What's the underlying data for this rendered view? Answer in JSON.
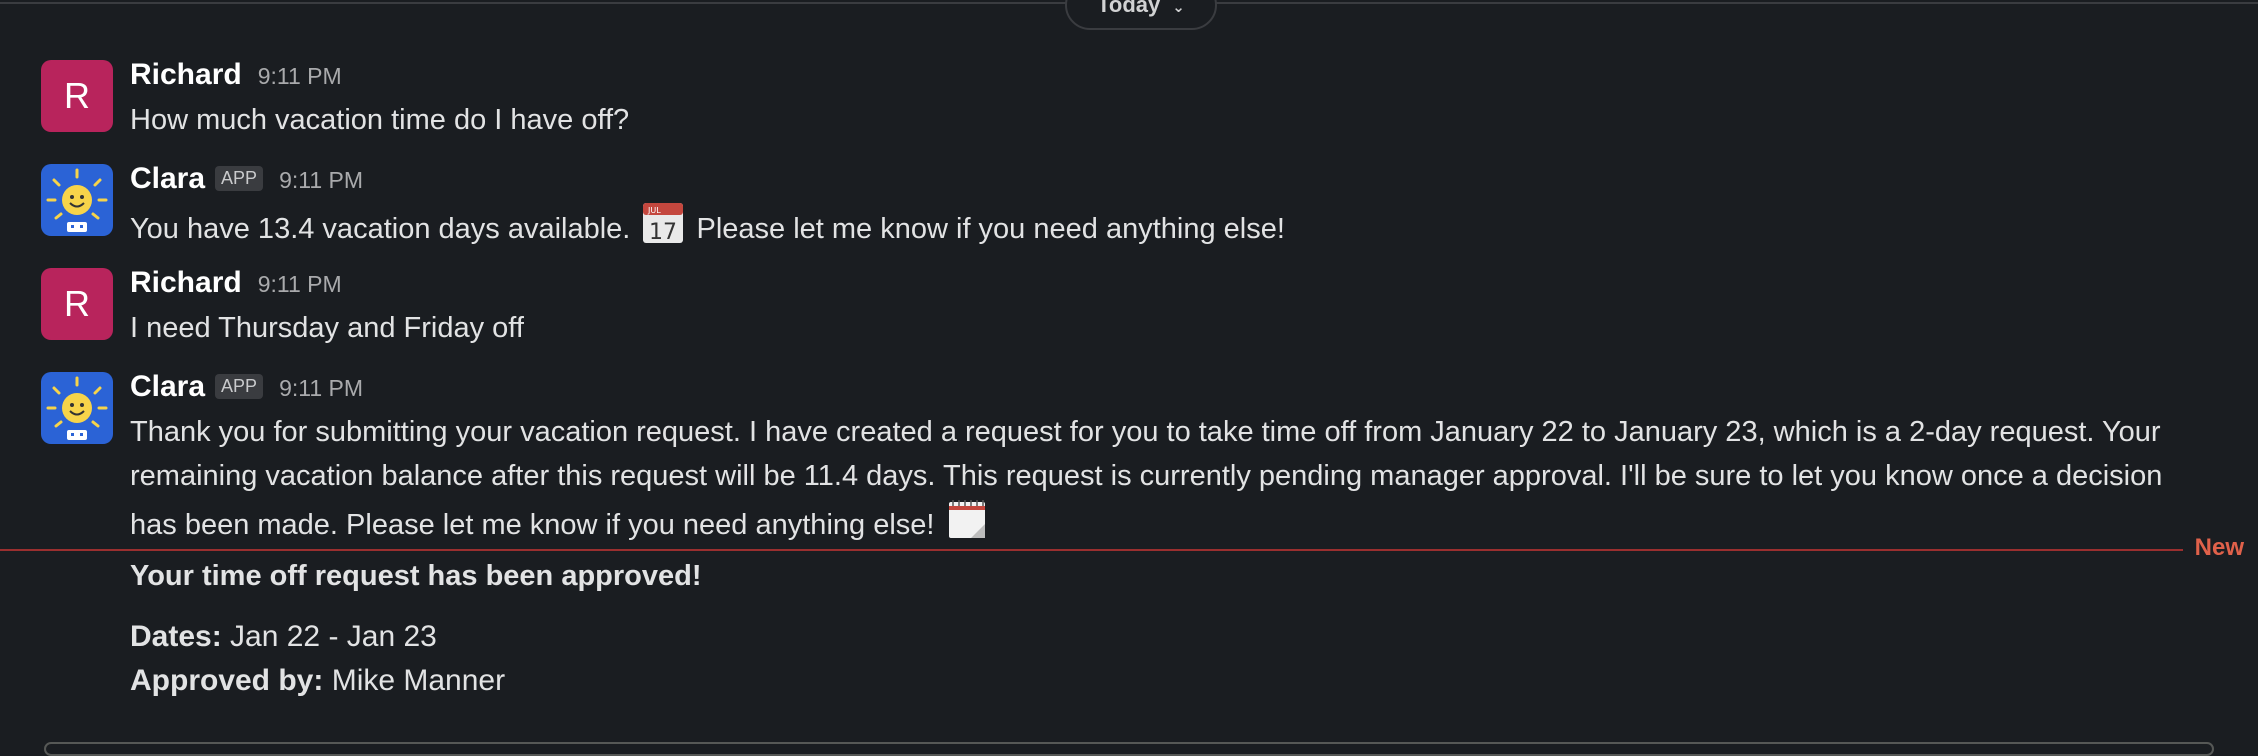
{
  "day_divider": {
    "label": "Today"
  },
  "messages": [
    {
      "author": "Richard",
      "initial": "R",
      "time": "9:11 PM",
      "text": "How much vacation time do I have off?"
    },
    {
      "author": "Clara",
      "badge": "APP",
      "time": "9:11 PM",
      "text_before": "You have 13.4 vacation days available.",
      "text_after": "Please let me know if you need anything else!",
      "emoji_icon": "calendar-icon",
      "calendar_month": "JUL",
      "calendar_day": "17"
    },
    {
      "author": "Richard",
      "initial": "R",
      "time": "9:11 PM",
      "text": "I need Thursday and Friday off"
    },
    {
      "author": "Clara",
      "badge": "APP",
      "time": "9:11 PM",
      "line1": "Thank you for submitting your vacation request. I have created a request for you to take time off from January 22 to January 23, which is a 2-day request. Your",
      "line2": "remaining vacation balance after this request will be 11.4 days. This request is currently pending manager approval. I'll be sure to let you know once a decision",
      "line3": "has been made. Please let me know if you need anything else!",
      "emoji_icon": "spiral-calendar-icon"
    }
  ],
  "new_divider": {
    "label": "New"
  },
  "notification": {
    "title": "Your time off request has been approved!",
    "dates_label": "Dates:",
    "dates_value": "Jan 22 - Jan 23",
    "approved_label": "Approved by:",
    "approved_value": "Mike Manner"
  },
  "colors": {
    "background": "#1a1d21",
    "avatar_richard": "#b8245c",
    "avatar_clara": "#2b63d6",
    "new_accent": "#e0614a"
  }
}
